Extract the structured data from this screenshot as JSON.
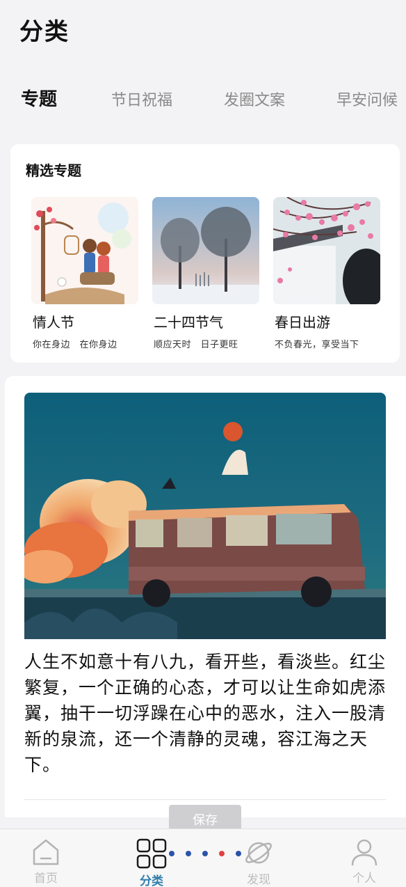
{
  "header": {
    "title": "分类"
  },
  "tabs": [
    {
      "label": "专题"
    },
    {
      "label": "节日祝福"
    },
    {
      "label": "发圈文案"
    },
    {
      "label": "早安问候"
    }
  ],
  "featured": {
    "title": "精选专题",
    "topics": [
      {
        "name": "情人节",
        "desc": "你在身边　在你身边"
      },
      {
        "name": "二十四节气",
        "desc": "顺应天时　日子更旺"
      },
      {
        "name": "春日出游",
        "desc": "不负春光，享受当下"
      }
    ]
  },
  "quote": {
    "text": "人生不如意十有八九，看开些，看淡些。红尘繁复，一个正确的心态，才可以让生命如虎添翼，抽干一切浮躁在心中的恶水，注入一股清新的泉流，还一个清静的灵魂，容江海之天下。"
  },
  "actions": {
    "save_label": "保存"
  },
  "bottom_nav": {
    "items": [
      {
        "label": "首页",
        "icon": "home-icon"
      },
      {
        "label": "分类",
        "icon": "grid-icon",
        "active": true
      },
      {
        "label": "发现",
        "icon": "planet-icon"
      },
      {
        "label": "个人",
        "icon": "user-icon"
      }
    ]
  },
  "colors": {
    "accent": "#2f7ea9",
    "dot_active": "#e0413f",
    "dot": "#2b54a8"
  }
}
